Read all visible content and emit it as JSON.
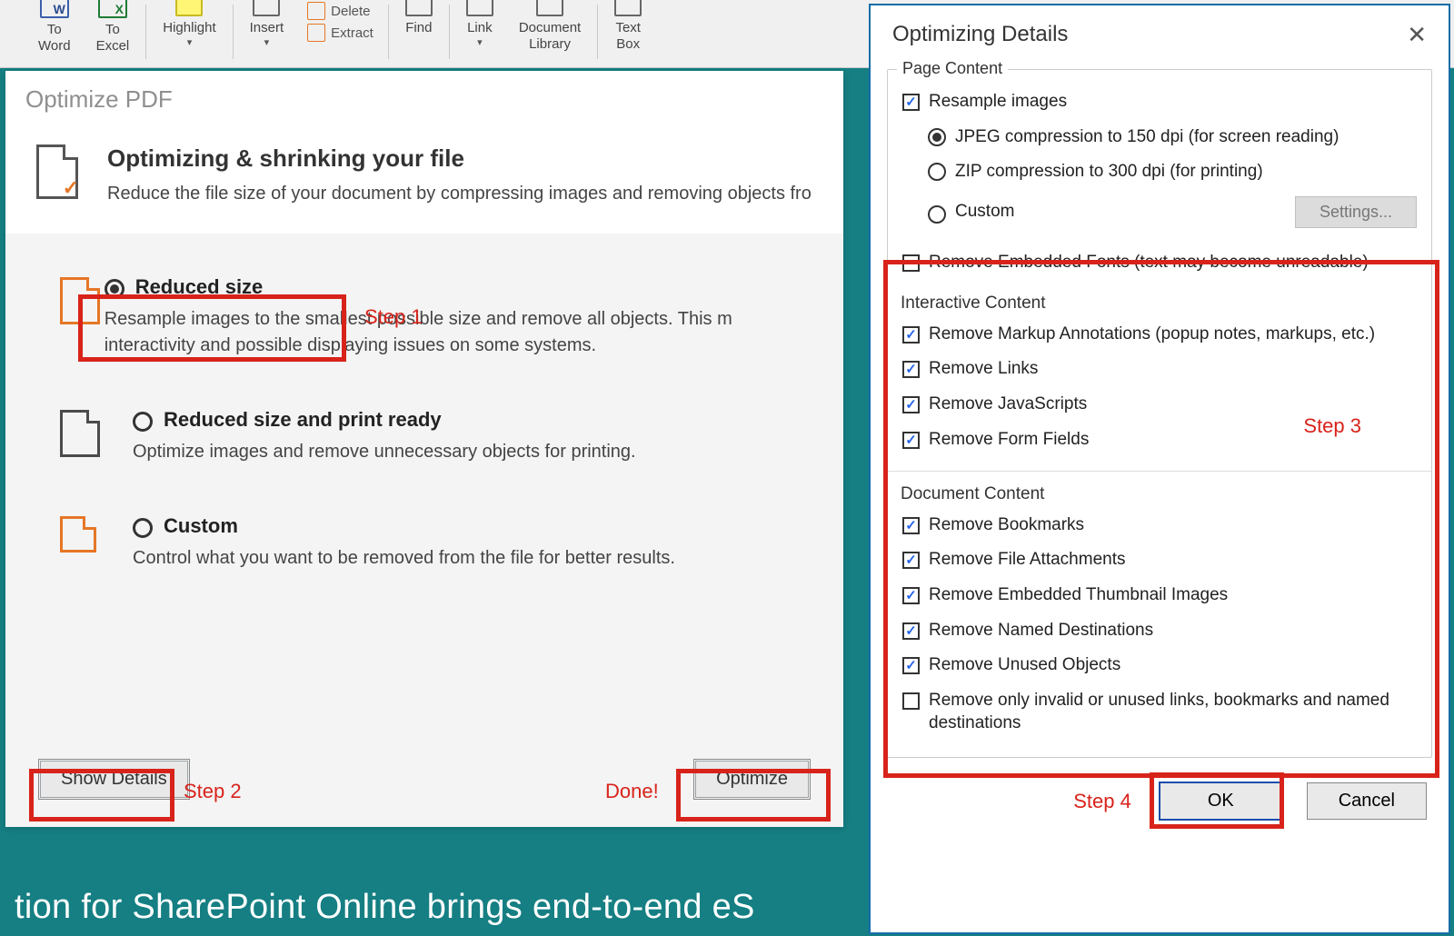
{
  "ribbon": {
    "to_word": "To\nWord",
    "to_excel": "To\nExcel",
    "highlight": "Highlight",
    "insert": "Insert",
    "delete": "Delete",
    "extract": "Extract",
    "find": "Find",
    "link": "Link",
    "doclib": "Document\nLibrary",
    "textbox": "Text\nBox"
  },
  "optimize_pane": {
    "window_title": "Optimize PDF",
    "heading": "Optimizing & shrinking your file",
    "subheading": "Reduce the file size of your document by compressing images and removing objects fro",
    "options": [
      {
        "title": "Reduced size",
        "desc": "Resample images to the smallest possible size and remove all objects. This m  interactivity and possible displaying issues on some systems.",
        "selected": true
      },
      {
        "title": "Reduced size and print ready",
        "desc": "Optimize images and remove unnecessary objects for printing.",
        "selected": false
      },
      {
        "title": "Custom",
        "desc": "Control what you want to be removed from the file for better results.",
        "selected": false
      }
    ],
    "show_details": "Show Details",
    "optimize": "Optimize",
    "done_label": "Done!",
    "step1": "Step 1",
    "step2": "Step 2"
  },
  "details": {
    "title": "Optimizing Details",
    "page_content_legend": "Page Content",
    "resample": "Resample images",
    "jpeg": "JPEG compression to 150 dpi (for screen reading)",
    "zip": "ZIP compression to 300 dpi (for printing)",
    "custom": "Custom",
    "settings": "Settings...",
    "remove_fonts": "Remove Embedded Fonts (text may become unreadable)",
    "interactive_legend": "Interactive Content",
    "rm_markup": "Remove Markup Annotations (popup notes, markups, etc.)",
    "rm_links": "Remove Links",
    "rm_js": "Remove JavaScripts",
    "rm_form": "Remove Form Fields",
    "doc_content_legend": "Document Content",
    "rm_bm": "Remove Bookmarks",
    "rm_att": "Remove File Attachments",
    "rm_thumb": "Remove Embedded Thumbnail Images",
    "rm_named": "Remove Named Destinations",
    "rm_unused": "Remove Unused Objects",
    "rm_invalid": "Remove only invalid or unused links, bookmarks and named destinations",
    "step3": "Step 3",
    "step4": "Step 4",
    "ok": "OK",
    "cancel": "Cancel"
  },
  "footer": "tion for SharePoint Online brings end-to-end eS"
}
